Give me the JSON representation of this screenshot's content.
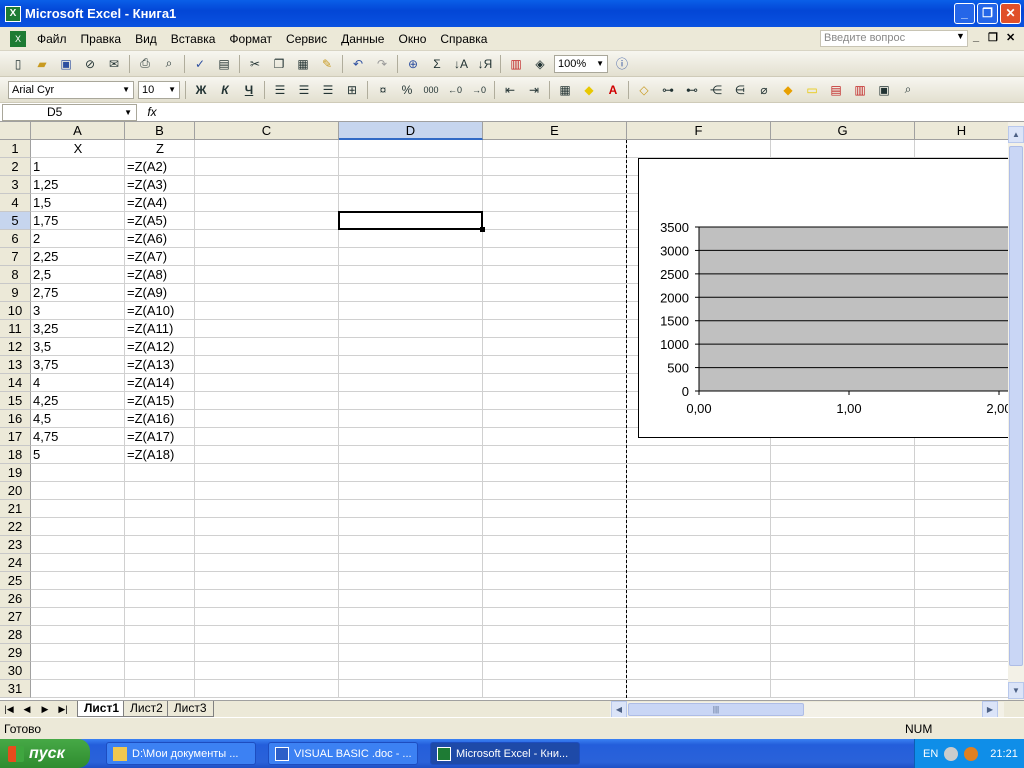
{
  "window": {
    "title": "Microsoft Excel - Книга1"
  },
  "menu": {
    "items": [
      "Файл",
      "Правка",
      "Вид",
      "Вставка",
      "Формат",
      "Сервис",
      "Данные",
      "Окно",
      "Справка"
    ],
    "help_placeholder": "Введите вопрос"
  },
  "toolbar": {
    "zoom": "100%",
    "font_name": "Arial Cyr",
    "font_size": "10",
    "bold_label": "Ж",
    "italic_label": "К",
    "underline_label": "Ч",
    "percent_label": "%",
    "thousands_label": "000",
    "sigma_label": "Σ"
  },
  "formula_bar": {
    "name_box": "D5",
    "fx_label": "fx",
    "content": ""
  },
  "sheet": {
    "columns": [
      "A",
      "B",
      "C",
      "D",
      "E",
      "F",
      "G",
      "H"
    ],
    "selected_column": "D",
    "selected_row": "5",
    "rows": [
      "1",
      "2",
      "3",
      "4",
      "5",
      "6",
      "7",
      "8",
      "9",
      "10",
      "11",
      "12",
      "13",
      "14",
      "15",
      "16",
      "17",
      "18",
      "19",
      "20",
      "21",
      "22",
      "23",
      "24",
      "25",
      "26",
      "27",
      "28",
      "29",
      "30",
      "31"
    ],
    "col_a": [
      "X",
      "1",
      "1,25",
      "1,5",
      "1,75",
      "2",
      "2,25",
      "2,5",
      "2,75",
      "3",
      "3,25",
      "3,5",
      "3,75",
      "4",
      "4,25",
      "4,5",
      "4,75",
      "5"
    ],
    "col_b": [
      "Z",
      "=Z(A2)",
      "=Z(A3)",
      "=Z(A4)",
      "=Z(A5)",
      "=Z(A6)",
      "=Z(A7)",
      "=Z(A8)",
      "=Z(A9)",
      "=Z(A10)",
      "=Z(A11)",
      "=Z(A12)",
      "=Z(A13)",
      "=Z(A14)",
      "=Z(A15)",
      "=Z(A16)",
      "=Z(A17)",
      "=Z(A18)"
    ]
  },
  "chart_data": {
    "type": "area",
    "plot_color": "#c0c0c0",
    "y_ticks": [
      "0",
      "500",
      "1000",
      "1500",
      "2000",
      "2500",
      "3000",
      "3500"
    ],
    "x_ticks": [
      "0,00",
      "1,00",
      "2,00"
    ],
    "ylim": [
      0,
      3500
    ],
    "xlim": [
      0,
      2.2
    ],
    "grid": true
  },
  "tabs": [
    "Лист1",
    "Лист2",
    "Лист3"
  ],
  "active_tab": "Лист1",
  "status": {
    "left": "Готово",
    "num": "NUM"
  },
  "taskbar": {
    "start_label": "пуск",
    "tasks": [
      "D:\\Мои документы ...",
      "VISUAL BASIC .doc - ...",
      "Microsoft Excel - Кни..."
    ],
    "active_task": 2,
    "lang": "EN",
    "clock": "21:21"
  }
}
